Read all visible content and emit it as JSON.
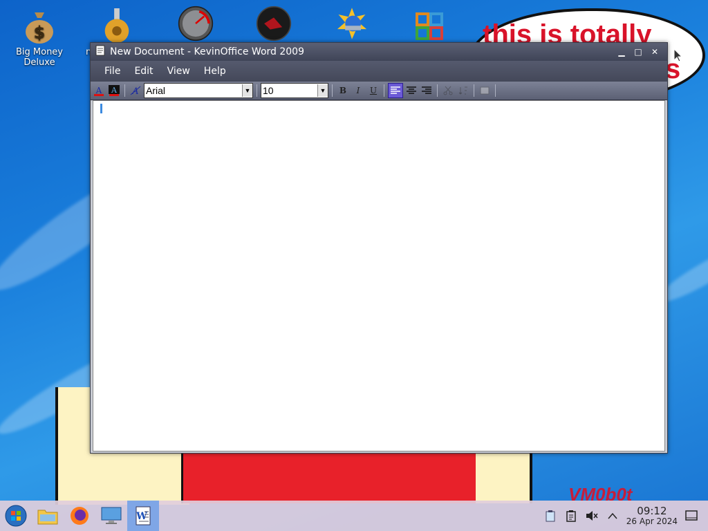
{
  "desktop": {
    "icons": [
      {
        "label": "Big Money\nDeluxe",
        "name": "money-bag-icon"
      },
      {
        "label": "n",
        "name": "gear-icon"
      },
      {
        "label": "",
        "name": "speedometer-icon"
      },
      {
        "label": "",
        "name": "radar-icon"
      },
      {
        "label": "",
        "name": "sun-globe-icon"
      },
      {
        "label": "",
        "name": "office-logo-icon"
      }
    ],
    "bubble_text": "this is totally",
    "bubble_text_2": "s",
    "watermark": "VM0b0t"
  },
  "window": {
    "title": "New Document - KevinOffice Word 2009",
    "menu": [
      "File",
      "Edit",
      "View",
      "Help"
    ],
    "toolbar": {
      "font": "Arial",
      "size": "10",
      "bold": "B",
      "italic": "I",
      "underline": "U"
    },
    "document_text": ""
  },
  "taskbar": {
    "time": "09:12",
    "date": "26 Apr 2024"
  },
  "colors": {
    "accent_red": "#d9132a",
    "window_chrome": "#4a4f63",
    "taskbar": "#e1cedc"
  }
}
